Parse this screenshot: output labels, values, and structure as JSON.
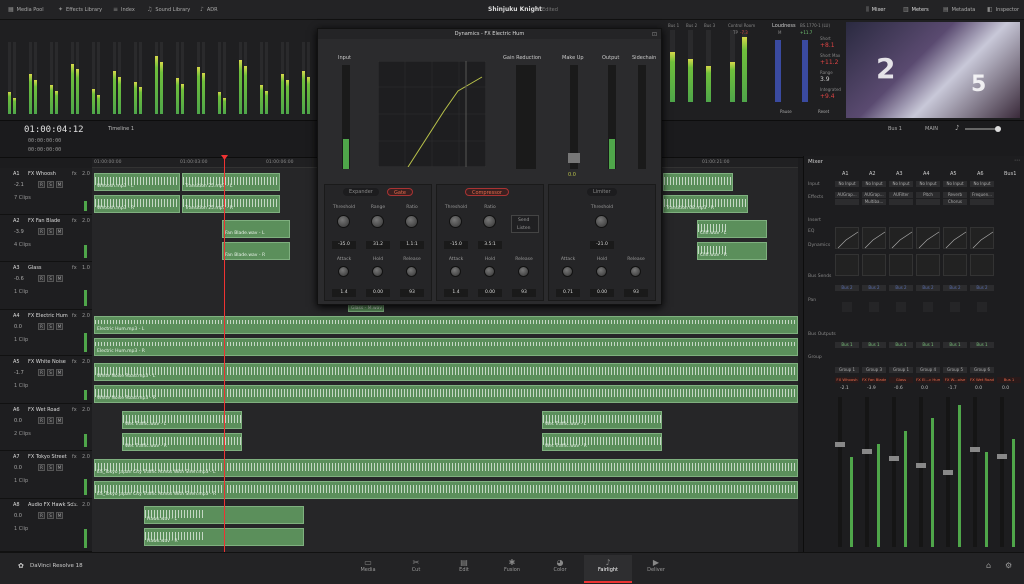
{
  "topbar": {
    "media_pool": "Media Pool",
    "effects_library": "Effects Library",
    "index": "Index",
    "sound_library": "Sound Library",
    "adr": "ADR",
    "project_title": "Shinjuku Knight",
    "project_status": "Edited",
    "mixer": "Mixer",
    "meters": "Meters",
    "metadata": "Metadata",
    "inspector": "Inspector"
  },
  "meters_top": {
    "bus_labels": [
      "Bus 1",
      "Bus 2",
      "Bus 3"
    ],
    "control_room": "Control Room",
    "tp_label": "TP",
    "tp_value": "-7.3",
    "loudness": "Loudness",
    "loudness_std": "BS.1770-1 (LU)",
    "m_label": "M",
    "m_value": "+11.7",
    "short": "Short",
    "short_val": "+8.1",
    "short_max": "Short Max",
    "short_max_val": "+11.2",
    "range": "Range",
    "range_val": "3.9",
    "integrated": "Integrated",
    "integrated_val": "+9.4",
    "pause": "Pause",
    "reset": "Reset"
  },
  "transport": {
    "timecode": "01:00:04:12",
    "tc_h": "00:00:00:00",
    "tc_m": "00:00:00:00",
    "tc_s": "00:00:00:00",
    "timeline_name": "Timeline 1",
    "bus_select": "Bus 1",
    "main_select": "MAIN"
  },
  "ruler": [
    "01:00:00:00",
    "01:00:03:00",
    "01:00:06:00",
    "01:00:21:00"
  ],
  "tracks": [
    {
      "id": "A1",
      "name": "FX Whoosh",
      "ch": "2.0",
      "vol": "-2.1",
      "clips": "7 Clips"
    },
    {
      "id": "A2",
      "name": "FX Fan Blade",
      "ch": "2.0",
      "vol": "-3.9",
      "clips": "4 Clips"
    },
    {
      "id": "A3",
      "name": "Glass",
      "ch": "1.0",
      "vol": "-0.6",
      "clips": "1 Clip"
    },
    {
      "id": "A4",
      "name": "FX Electric Hum",
      "ch": "2.0",
      "vol": "0.0",
      "clips": "1 Clip"
    },
    {
      "id": "A5",
      "name": "FX White Noise",
      "ch": "2.0",
      "vol": "-1.7",
      "clips": "1 Clip"
    },
    {
      "id": "A6",
      "name": "FX Wet Road",
      "ch": "2.0",
      "vol": "0.0",
      "clips": "2 Clips"
    },
    {
      "id": "A7",
      "name": "FX Tokyo Street",
      "ch": "2.0",
      "vol": "0.0",
      "clips": "1 Clip"
    },
    {
      "id": "A8",
      "name": "Audio FX Hawk Sc...",
      "ch": "2.0",
      "vol": "0.0",
      "clips": "1 Clip"
    }
  ],
  "clips": {
    "whoosh_l": "Whoosh.mp3 - L",
    "whoosh_r": "Whoosh.mp3 - R",
    "transition_l": "Transition 25.mp3 - L",
    "transition_r": "Transition 25.mp3 - R",
    "transition2_r": "Transition 08.mp3 - R",
    "fanblade_l": "Fan Blade.wav - L",
    "fanblade_r": "Fan Blade.wav - R",
    "cliff_l": "Cliff.wav - L",
    "cliff_r": "Cliff.wav - R",
    "glass": "Glass - M.wav",
    "hum_l": "Electric Hum.mp3 - L",
    "hum_r": "Electric Hum.mp3 - R",
    "noise_l": "White Noise Road.mp3 - L",
    "noise_r": "White Noise Road.mp3 - R",
    "wet_l": "Wet Traffic.wav - L",
    "wet_r": "Wet Traffic.wav - R",
    "tokyo_l": "ES_Tokyo Japan City Traffic Atmos With Siren.mp3 - L",
    "tokyo_r": "ES_Tokyo Japan City Traffic Atmos With Siren.mp3 - R",
    "hawk_l": "Hawk.wav - L",
    "hawk_r": "Hawk.wav - R"
  },
  "dynamics": {
    "title": "Dynamics - FX Electric Hum",
    "input": "Input",
    "gain_reduction": "Gain Reduction",
    "make_up": "Make Up",
    "output": "Output",
    "sidechain": "Sidechain",
    "makeup_val": "0.0",
    "expander": "Expander",
    "gate": "Gate",
    "compressor": "Compressor",
    "limiter": "Limiter",
    "send": "Send",
    "listen": "Listen",
    "threshold": "Threshold",
    "range": "Range",
    "ratio": "Ratio",
    "attack": "Attack",
    "hold": "Hold",
    "release": "Release",
    "gate_threshold": "-35.0",
    "gate_range": "31.2",
    "gate_ratio": "1.1:1",
    "gate_attack": "1.4",
    "gate_hold": "0.00",
    "gate_release": "93",
    "comp_threshold": "-15.0",
    "comp_ratio": "3.5:1",
    "comp_attack": "1.4",
    "comp_hold": "0.00",
    "comp_release": "93",
    "lim_threshold": "-21.0",
    "lim_attack": "0.71",
    "lim_hold": "0.00",
    "lim_release": "93"
  },
  "mixer": {
    "title": "Mixer",
    "channels": [
      "A1",
      "A2",
      "A3",
      "A4",
      "A5",
      "A6",
      "Bus1"
    ],
    "row_input": "Input",
    "row_effects": "Effects",
    "row_insert": "Insert",
    "row_eq": "EQ",
    "row_dynamics": "Dynamics",
    "row_bus_sends": "Bus Sends",
    "row_pan": "Pan",
    "row_bus_outputs": "Bus Outputs",
    "row_group": "Group",
    "input_vals": [
      "No Input",
      "No Input",
      "No Input",
      "No Input",
      "No Input",
      "No Input"
    ],
    "fx_vals": [
      "AUGrap...",
      "AUGrap...",
      "AUFilter",
      "Pitch",
      "Reverb",
      "Frequen..."
    ],
    "fx2_vals": [
      "",
      "Multiba...",
      "",
      "",
      "Chorus",
      ""
    ],
    "bus_out": [
      "Bus 1",
      "Bus 1",
      "Bus 1",
      "Bus 1",
      "Bus 1",
      "Bus 1"
    ],
    "groups": [
      "Group 1",
      "Group 3",
      "Group 1",
      "Group 4",
      "Group 5",
      "Group 6"
    ],
    "names": [
      "FX Whoosh",
      "FX Fan Blade",
      "Glass",
      "FX El...c Hum",
      "FX W...oise",
      "FX Wet Road",
      "Bus 1"
    ],
    "vols": [
      "-2.1",
      "-3.9",
      "-0.6",
      "0.0",
      "-1.7",
      "0.0",
      "0.0"
    ]
  },
  "bottombar": {
    "app": "DaVinci Resolve 18",
    "pages": [
      "Media",
      "Cut",
      "Edit",
      "Fusion",
      "Color",
      "Fairlight",
      "Deliver"
    ],
    "active_page": "Fairlight"
  },
  "colors": {
    "clip": "#5b8f5b",
    "accent_red": "#e33333",
    "meter_green": "#4fa64a",
    "meter_yellow": "#d6d84a"
  }
}
